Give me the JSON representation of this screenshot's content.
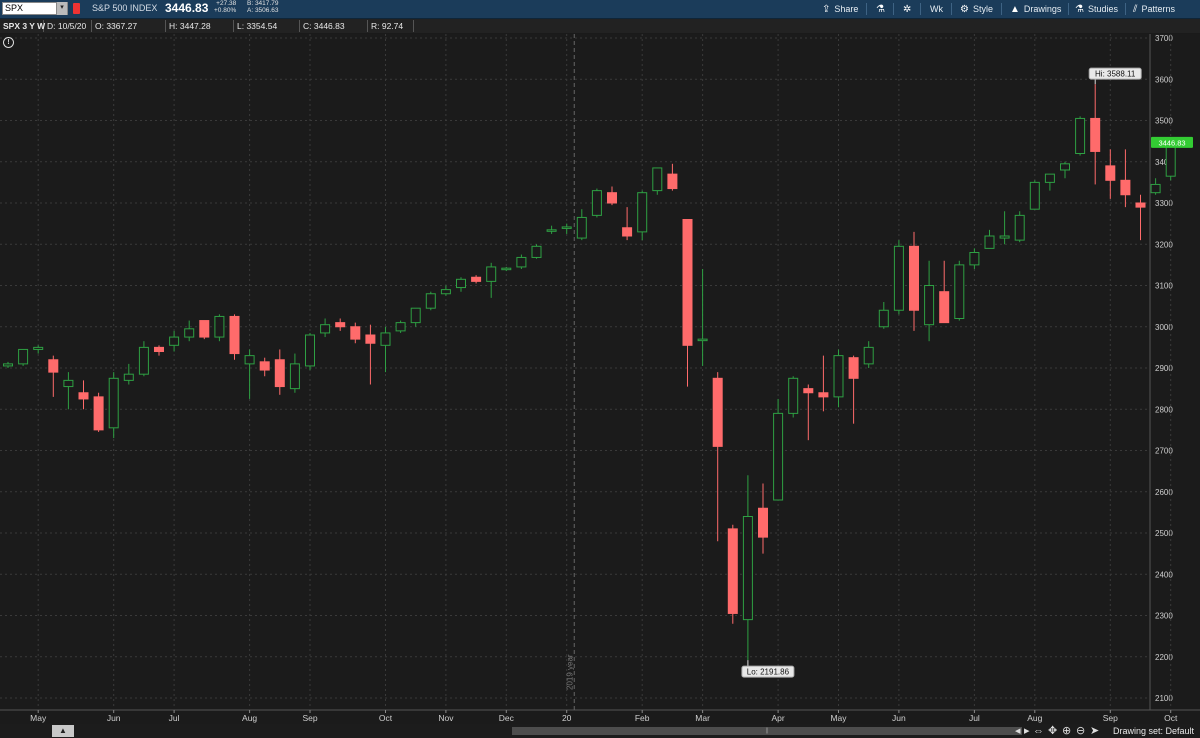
{
  "toolbar": {
    "symbol": "SPX",
    "dropdown_glyph": "▾",
    "index_name": "S&P 500 INDEX",
    "last_price": "3446.83",
    "net_change": "+27.38",
    "net_change_pct": "+0.80%",
    "bid": "B: 3417.79",
    "ask": "A: 3506.63",
    "share_label": "Share",
    "wk_label": "Wk",
    "style_label": "Style",
    "drawings_label": "Drawings",
    "studies_label": "Studies",
    "patterns_label": "Patterns"
  },
  "infobar": {
    "chart_label": "SPX 3 Y W",
    "date": "D: 10/5/20",
    "open": "O: 3367.27",
    "high": "H: 3447.28",
    "low": "L: 3354.54",
    "close": "C: 3446.83",
    "range": "R: 92.74"
  },
  "bottombar": {
    "drawing_set": "Drawing set: Default"
  },
  "colors": {
    "background": "#1a1a1a",
    "up": "#2ea043",
    "down": "#ff6b6b",
    "grid": "#3a3a3a",
    "price_tag": "#33cc33"
  },
  "chart_data": {
    "type": "candlestick",
    "interval": "weekly",
    "ylim": [
      2100,
      3700
    ],
    "yticks": [
      2100,
      2200,
      2300,
      2400,
      2500,
      2600,
      2700,
      2800,
      2900,
      3000,
      3100,
      3200,
      3300,
      3400,
      3500,
      3600,
      3700
    ],
    "xticks": [
      {
        "label": "May",
        "index": 2
      },
      {
        "label": "Jun",
        "index": 7
      },
      {
        "label": "Jul",
        "index": 11
      },
      {
        "label": "Aug",
        "index": 16
      },
      {
        "label": "Sep",
        "index": 20
      },
      {
        "label": "Oct",
        "index": 25
      },
      {
        "label": "Nov",
        "index": 29
      },
      {
        "label": "Dec",
        "index": 33
      },
      {
        "label": "20",
        "index": 37
      },
      {
        "label": "Feb",
        "index": 42
      },
      {
        "label": "Mar",
        "index": 46
      },
      {
        "label": "Apr",
        "index": 51
      },
      {
        "label": "May",
        "index": 55
      },
      {
        "label": "Jun",
        "index": 59
      },
      {
        "label": "Jul",
        "index": 64
      },
      {
        "label": "Aug",
        "index": 68
      },
      {
        "label": "Sep",
        "index": 73
      },
      {
        "label": "Oct",
        "index": 77
      }
    ],
    "year_divider": {
      "index": 37.5,
      "label": "2019 year"
    },
    "last_price_tag": 3446.83,
    "annotations": [
      {
        "text": "Hi: 3588.11",
        "index": 72,
        "value": 3588.11
      },
      {
        "text": "Lo: 2191.86",
        "index": 49,
        "value": 2191.86
      }
    ],
    "candles": [
      [
        2905,
        2915,
        2900,
        2910
      ],
      [
        2910,
        2945,
        2905,
        2945
      ],
      [
        2945,
        2955,
        2935,
        2950
      ],
      [
        2920,
        2930,
        2830,
        2890
      ],
      [
        2855,
        2890,
        2800,
        2870
      ],
      [
        2840,
        2870,
        2800,
        2825
      ],
      [
        2830,
        2840,
        2745,
        2750
      ],
      [
        2755,
        2890,
        2730,
        2875
      ],
      [
        2870,
        2910,
        2860,
        2885
      ],
      [
        2885,
        2965,
        2880,
        2950
      ],
      [
        2950,
        2955,
        2930,
        2940
      ],
      [
        2955,
        2990,
        2940,
        2975
      ],
      [
        2975,
        3015,
        2965,
        2995
      ],
      [
        3015,
        3015,
        2970,
        2975
      ],
      [
        2975,
        3030,
        2965,
        3025
      ],
      [
        3025,
        3030,
        2920,
        2935
      ],
      [
        2910,
        2945,
        2825,
        2930
      ],
      [
        2915,
        2925,
        2880,
        2895
      ],
      [
        2920,
        2945,
        2835,
        2855
      ],
      [
        2850,
        2935,
        2840,
        2910
      ],
      [
        2905,
        2985,
        2895,
        2980
      ],
      [
        2985,
        3020,
        2975,
        3005
      ],
      [
        3010,
        3020,
        2990,
        3000
      ],
      [
        3000,
        3010,
        2960,
        2970
      ],
      [
        2980,
        3005,
        2860,
        2960
      ],
      [
        2955,
        3000,
        2890,
        2985
      ],
      [
        2990,
        3015,
        2985,
        3010
      ],
      [
        3010,
        3040,
        3000,
        3045
      ],
      [
        3045,
        3085,
        3040,
        3080
      ],
      [
        3080,
        3100,
        3075,
        3090
      ],
      [
        3095,
        3120,
        3085,
        3115
      ],
      [
        3120,
        3125,
        3105,
        3110
      ],
      [
        3110,
        3155,
        3070,
        3145
      ],
      [
        3140,
        3145,
        3135,
        3142
      ],
      [
        3145,
        3175,
        3140,
        3168
      ],
      [
        3168,
        3200,
        3165,
        3195
      ],
      [
        3235,
        3245,
        3225,
        3235
      ],
      [
        3240,
        3250,
        3225,
        3242
      ],
      [
        3215,
        3285,
        3210,
        3265
      ],
      [
        3270,
        3335,
        3265,
        3330
      ],
      [
        3325,
        3340,
        3295,
        3300
      ],
      [
        3240,
        3290,
        3210,
        3220
      ],
      [
        3230,
        3330,
        3210,
        3325
      ],
      [
        3330,
        3385,
        3320,
        3385
      ],
      [
        3370,
        3395,
        3330,
        3335
      ],
      [
        3260,
        3260,
        2855,
        2955
      ],
      [
        2970,
        3140,
        2905,
        2970
      ],
      [
        2875,
        2890,
        2480,
        2710
      ],
      [
        2510,
        2520,
        2280,
        2305
      ],
      [
        2290,
        2640,
        2192,
        2540
      ],
      [
        2560,
        2620,
        2450,
        2490
      ],
      [
        2580,
        2825,
        2580,
        2790
      ],
      [
        2790,
        2880,
        2780,
        2875
      ],
      [
        2850,
        2860,
        2725,
        2840
      ],
      [
        2840,
        2930,
        2795,
        2830
      ],
      [
        2830,
        2945,
        2805,
        2930
      ],
      [
        2925,
        2930,
        2765,
        2875
      ],
      [
        2910,
        2965,
        2900,
        2950
      ],
      [
        3000,
        3060,
        2995,
        3040
      ],
      [
        3040,
        3210,
        3030,
        3195
      ],
      [
        3195,
        3230,
        2990,
        3040
      ],
      [
        3005,
        3160,
        2965,
        3100
      ],
      [
        3085,
        3160,
        3010,
        3010
      ],
      [
        3020,
        3160,
        3015,
        3150
      ],
      [
        3150,
        3190,
        3140,
        3180
      ],
      [
        3190,
        3235,
        3190,
        3220
      ],
      [
        3215,
        3280,
        3200,
        3220
      ],
      [
        3210,
        3280,
        3205,
        3270
      ],
      [
        3285,
        3355,
        3285,
        3350
      ],
      [
        3350,
        3370,
        3330,
        3370
      ],
      [
        3380,
        3400,
        3360,
        3395
      ],
      [
        3420,
        3510,
        3415,
        3505
      ],
      [
        3505,
        3588,
        3345,
        3425
      ],
      [
        3390,
        3430,
        3310,
        3355
      ],
      [
        3355,
        3430,
        3290,
        3320
      ],
      [
        3300,
        3320,
        3210,
        3290
      ],
      [
        3325,
        3360,
        3320,
        3345
      ],
      [
        3365,
        3400,
        3355,
        3445
      ]
    ]
  }
}
